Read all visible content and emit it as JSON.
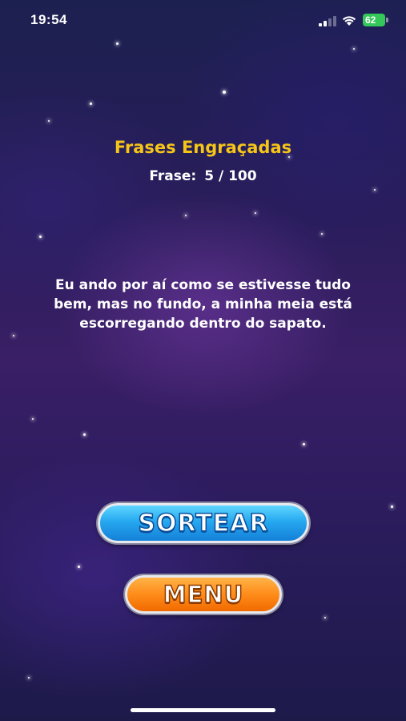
{
  "status_bar": {
    "time": "19:54",
    "battery": "62",
    "battery_color": "#34c759"
  },
  "game": {
    "title": "Frases Engraçadas",
    "counter_label": "Frase:",
    "counter_value": "5 / 100",
    "phrase": "Eu ando por aí como se estivesse tudo bem, mas no fundo, a minha meia está escorregando dentro do sapato."
  },
  "buttons": {
    "draw_label": "SORTEAR",
    "menu_label": "MENU"
  },
  "colors": {
    "title": "#f5c518",
    "draw_button": "#26a8f0",
    "menu_button": "#ff8c1a"
  },
  "icons": [
    "signal-icon",
    "wifi-icon",
    "battery-icon"
  ]
}
